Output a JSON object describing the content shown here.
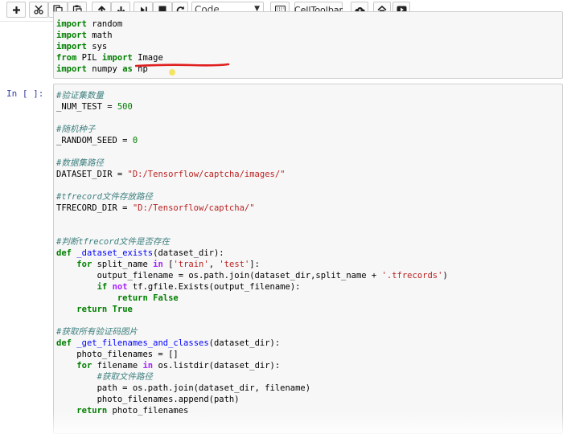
{
  "toolbar": {
    "buttons": [
      {
        "icon": "plus-icon",
        "title": "insert cell below"
      },
      {
        "icon": "scissors-icon",
        "title": "cut"
      },
      {
        "icon": "copy-icon",
        "title": "copy"
      },
      {
        "icon": "paste-icon",
        "title": "paste"
      },
      {
        "icon": "arrow-up-icon",
        "title": "move cell up"
      },
      {
        "icon": "arrow-down-icon",
        "title": "move cell down"
      },
      {
        "icon": "run-step-icon",
        "title": "run"
      },
      {
        "icon": "stop-icon",
        "title": "interrupt"
      },
      {
        "icon": "restart-icon",
        "title": "restart"
      }
    ],
    "cell_type": "Code",
    "celltoolbar_label": "CellToolbar",
    "extra_icons": [
      "keyboard-icon",
      "upload-icon",
      "home-icon",
      "play-icon"
    ]
  },
  "cell1": {
    "lines": [
      [
        [
          "kw",
          "import"
        ],
        [
          "t",
          " random"
        ]
      ],
      [
        [
          "kw",
          "import"
        ],
        [
          "t",
          " math"
        ]
      ],
      [
        [
          "kw",
          "import"
        ],
        [
          "t",
          " sys"
        ]
      ],
      [
        [
          "kw",
          "from"
        ],
        [
          "t",
          " PIL "
        ],
        [
          "kw",
          "import"
        ],
        [
          "t",
          " Image"
        ]
      ],
      [
        [
          "kw",
          "import"
        ],
        [
          "t",
          " numpy "
        ],
        [
          "kw",
          "as"
        ],
        [
          "t",
          " np"
        ]
      ]
    ]
  },
  "cell2": {
    "prompt": "In [ ]:",
    "lines": [
      [
        [
          "cm",
          "#验证集数量"
        ]
      ],
      [
        [
          "t",
          "_NUM_TEST = "
        ],
        [
          "nu",
          "500"
        ]
      ],
      [
        [
          "t",
          ""
        ]
      ],
      [
        [
          "cm",
          "#随机种子"
        ]
      ],
      [
        [
          "t",
          "_RANDOM_SEED = "
        ],
        [
          "nu",
          "0"
        ]
      ],
      [
        [
          "t",
          ""
        ]
      ],
      [
        [
          "cm",
          "#数据集路径"
        ]
      ],
      [
        [
          "t",
          "DATASET_DIR = "
        ],
        [
          "st",
          "\"D:/Tensorflow/captcha/images/\""
        ]
      ],
      [
        [
          "t",
          ""
        ]
      ],
      [
        [
          "cm",
          "#tfrecord文件存放路径"
        ]
      ],
      [
        [
          "t",
          "TFRECORD_DIR = "
        ],
        [
          "st",
          "\"D:/Tensorflow/captcha/\""
        ]
      ],
      [
        [
          "t",
          ""
        ]
      ],
      [
        [
          "t",
          ""
        ]
      ],
      [
        [
          "cm",
          "#判断tfrecord文件是否存在"
        ]
      ],
      [
        [
          "kw",
          "def"
        ],
        [
          "t",
          " "
        ],
        [
          "fn",
          "_dataset_exists"
        ],
        [
          "t",
          "(dataset_dir):"
        ]
      ],
      [
        [
          "t",
          "    "
        ],
        [
          "kw",
          "for"
        ],
        [
          "t",
          " split_name "
        ],
        [
          "op",
          "in"
        ],
        [
          "t",
          " ["
        ],
        [
          "st",
          "'train'"
        ],
        [
          "t",
          ", "
        ],
        [
          "st",
          "'test'"
        ],
        [
          "t",
          "]:"
        ]
      ],
      [
        [
          "t",
          "        output_filename = os.path.join(dataset_dir,split_name + "
        ],
        [
          "st",
          "'.tfrecords'"
        ],
        [
          "t",
          ")"
        ]
      ],
      [
        [
          "t",
          "        "
        ],
        [
          "kw",
          "if"
        ],
        [
          "t",
          " "
        ],
        [
          "op",
          "not"
        ],
        [
          "t",
          " tf.gfile.Exists(output_filename):"
        ]
      ],
      [
        [
          "t",
          "            "
        ],
        [
          "kw",
          "return"
        ],
        [
          "t",
          " "
        ],
        [
          "kw",
          "False"
        ]
      ],
      [
        [
          "t",
          "    "
        ],
        [
          "kw",
          "return"
        ],
        [
          "t",
          " "
        ],
        [
          "kw",
          "True"
        ]
      ],
      [
        [
          "t",
          ""
        ]
      ],
      [
        [
          "cm",
          "#获取所有验证码图片"
        ]
      ],
      [
        [
          "kw",
          "def"
        ],
        [
          "t",
          " "
        ],
        [
          "fn",
          "_get_filenames_and_classes"
        ],
        [
          "t",
          "(dataset_dir):"
        ]
      ],
      [
        [
          "t",
          "    photo_filenames = []"
        ]
      ],
      [
        [
          "t",
          "    "
        ],
        [
          "kw",
          "for"
        ],
        [
          "t",
          " filename "
        ],
        [
          "op",
          "in"
        ],
        [
          "t",
          " os.listdir(dataset_dir):"
        ]
      ],
      [
        [
          "t",
          "        "
        ],
        [
          "cm",
          "#获取文件路径"
        ]
      ],
      [
        [
          "t",
          "        path = os.path.join(dataset_dir, filename)"
        ]
      ],
      [
        [
          "t",
          "        photo_filenames.append(path)"
        ]
      ],
      [
        [
          "t",
          "    "
        ],
        [
          "kw",
          "return"
        ],
        [
          "t",
          " photo_filenames"
        ]
      ]
    ]
  },
  "annotation": {
    "underline_color": "#e02020"
  }
}
